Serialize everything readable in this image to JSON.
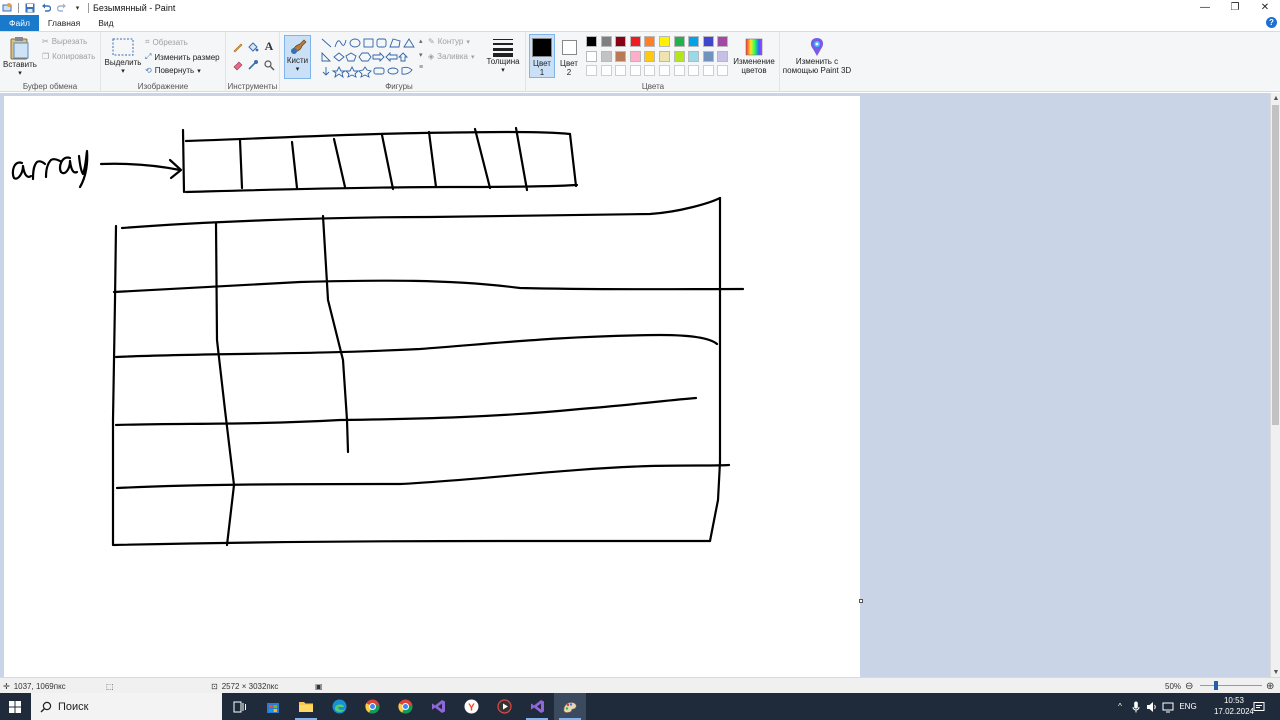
{
  "window": {
    "title": "Безымянный - Paint",
    "controls": {
      "minimize": "—",
      "restore": "❐",
      "close": "✕"
    }
  },
  "tabs": [
    {
      "label": "Файл"
    },
    {
      "label": "Главная"
    },
    {
      "label": "Вид"
    }
  ],
  "help": {
    "label": "?"
  },
  "ribbon": {
    "clipboard": {
      "group_label": "Буфер обмена",
      "paste": "Вставить",
      "cut": "Вырезать",
      "copy": "Копировать"
    },
    "image": {
      "group_label": "Изображение",
      "select": "Выделить",
      "crop": "Обрезать",
      "resize": "Изменить размер",
      "rotate": "Повернуть"
    },
    "tools": {
      "group_label": "Инструменты",
      "icons": [
        "pencil-icon",
        "fill-icon",
        "text-icon",
        "eraser-icon",
        "color-picker-icon",
        "magnifier-icon"
      ]
    },
    "brushes": {
      "label": "Кисти"
    },
    "shapes": {
      "group_label": "Фигуры",
      "outline": "Контур",
      "fill": "Заливка"
    },
    "size": {
      "label": "Толщина"
    },
    "colors": {
      "group_label": "Цвета",
      "color1": "Цвет 1",
      "color2": "Цвет 2",
      "edit_colors": "Изменение цветов",
      "paint3d": "Изменить с помощью Paint 3D",
      "color1_value": "#000000",
      "color2_value": "#ffffff",
      "palette_row1": [
        "#000000",
        "#7f7f7f",
        "#880015",
        "#ed1c24",
        "#ff7f27",
        "#fff200",
        "#22b14c",
        "#00a2e8",
        "#3f48cc",
        "#a349a4"
      ],
      "palette_row2": [
        "#ffffff",
        "#c3c3c3",
        "#b97a57",
        "#ffaec9",
        "#ffc90e",
        "#efe4b0",
        "#b5e61d",
        "#99d9ea",
        "#7092be",
        "#c8bfe7"
      ],
      "palette_row3": [
        "#ffffff",
        "#ffffff",
        "#ffffff",
        "#ffffff",
        "#ffffff",
        "#ffffff",
        "#ffffff",
        "#ffffff",
        "#ffffff",
        "#ffffff"
      ]
    }
  },
  "canvas": {
    "handwritten_text": "array"
  },
  "statusbar": {
    "cursor_pos": "1037, 1069пкс",
    "image_size": "2572 × 3032пкс",
    "zoom": "50%",
    "zoom_fraction": 0.5
  },
  "taskbar": {
    "search_placeholder": "Поиск",
    "language": "ENG",
    "time": "10:53",
    "date": "17.02.2024"
  }
}
